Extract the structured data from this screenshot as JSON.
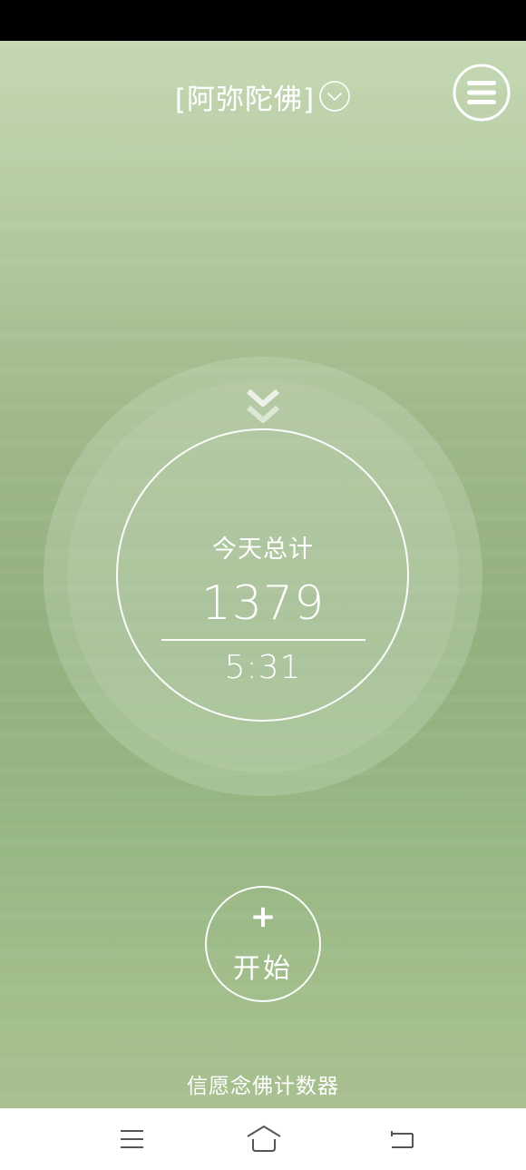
{
  "header": {
    "title": "[阿弥陀佛]",
    "dropdown_icon": "chevron-down-circle-icon",
    "menu_icon": "menu-circle-icon"
  },
  "counter": {
    "label": "今天总计",
    "count": "1379",
    "time": "5:31",
    "indicator_icon": "double-chevron-down-icon"
  },
  "start_button": {
    "icon": "plus-icon",
    "icon_glyph": "+",
    "label": "开始"
  },
  "footer": {
    "app_name": "信愿念佛计数器"
  },
  "nav_bar": {
    "items": [
      "menu-icon",
      "home-icon",
      "back-icon"
    ]
  },
  "colors": {
    "background_top": "#c4d8b3",
    "background_mid": "#93b07f",
    "background_bottom": "#a8bf90",
    "text": "#ffffff",
    "nav_icon": "#555555"
  }
}
